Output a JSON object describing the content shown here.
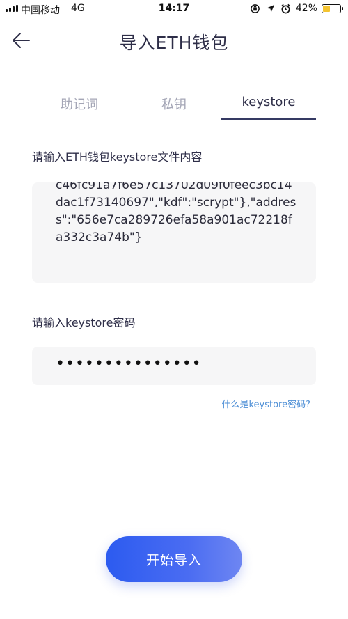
{
  "status_bar": {
    "carrier": "中国移动",
    "network": "4G",
    "time": "14:17",
    "battery_percent": "42%",
    "battery_level": 0.42,
    "icons": [
      "signal-icon",
      "lock-rotation-icon",
      "location-icon",
      "alarm-icon",
      "battery-icon"
    ]
  },
  "header": {
    "title": "导入ETH钱包",
    "back_icon": "back-arrow-icon"
  },
  "tabs": {
    "items": [
      {
        "label": "助记词",
        "active": false
      },
      {
        "label": "私钥",
        "active": false
      },
      {
        "label": "keystore",
        "active": true
      }
    ]
  },
  "keystore_field": {
    "label": "请输入ETH钱包keystore文件内容",
    "value": "c46fc91a7f6e57c13702d09f0feec3bc14dac1f73140697\",\"kdf\":\"scrypt\"},\"address\":\"656e7ca289726efa58a901ac72218fa332c3a74b\"}"
  },
  "password_field": {
    "label": "请输入keystore密码",
    "value": "•••••••••••••••"
  },
  "help_link": "什么是keystore密码?",
  "start_button": "开始导入",
  "colors": {
    "accent": "#2c5bf0",
    "tab_underline": "#353a63",
    "link": "#4e8fd6",
    "battery": "#f4c430"
  }
}
